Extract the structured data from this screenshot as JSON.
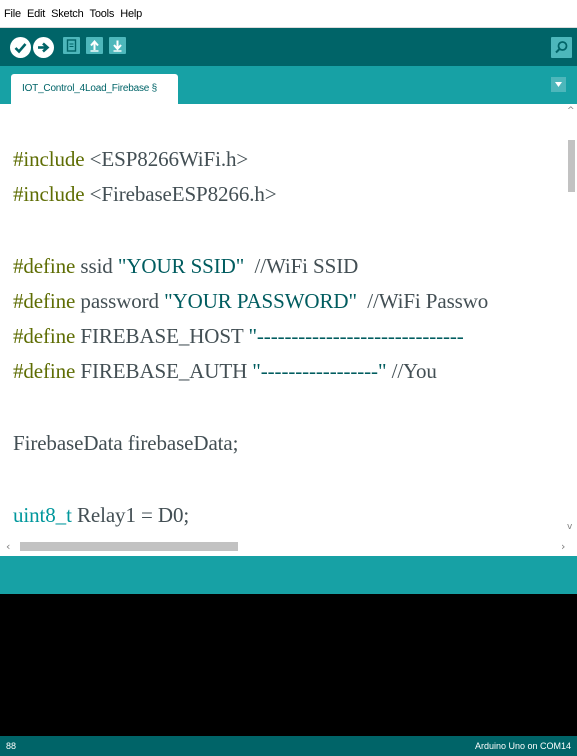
{
  "menu": [
    "File",
    "Edit",
    "Sketch",
    "Tools",
    "Help"
  ],
  "toolbar": {
    "buttons": [
      "verify-icon",
      "upload-icon",
      "new-icon",
      "open-icon",
      "save-icon"
    ],
    "serial_monitor_icon": "magnifier-icon"
  },
  "tab": {
    "label": "IOT_Control_4Load_Firebase §"
  },
  "code": [
    {
      "a": "#include",
      "b": " <ESP8266WiFi.h>",
      "c": ""
    },
    {
      "a": "#include",
      "b": " <FirebaseESP8266.h>",
      "c": ""
    },
    {
      "a": "",
      "b": "",
      "c": ""
    },
    {
      "a": "#define",
      "b": " ssid ",
      "c": "\"YOUR SSID\"",
      "d": "  //WiFi SSID"
    },
    {
      "a": "#define",
      "b": " password ",
      "c": "\"YOUR PASSWORD\"",
      "d": "  //WiFi Passwo"
    },
    {
      "a": "#define",
      "b": " FIREBASE_HOST ",
      "c": "\"------------------------------",
      "d": ""
    },
    {
      "a": "#define",
      "b": " FIREBASE_AUTH ",
      "c": "\"-----------------\"",
      "d": " //You"
    },
    {
      "a": "",
      "b": "",
      "c": ""
    },
    {
      "a": "",
      "b": "FirebaseData firebaseData;",
      "c": ""
    },
    {
      "a": "",
      "b": "",
      "c": ""
    },
    {
      "a": "uint8_t",
      "b": " Relay1 = D0;",
      "c": ""
    }
  ],
  "status": {
    "line": "88",
    "board": "Arduino Uno on COM14"
  },
  "colors": {
    "toolbar": "#006468",
    "tabbar": "#17a1a5",
    "button": "#4db7bb",
    "directive": "#5e6d03",
    "string": "#005c5f",
    "type": "#00979c"
  }
}
